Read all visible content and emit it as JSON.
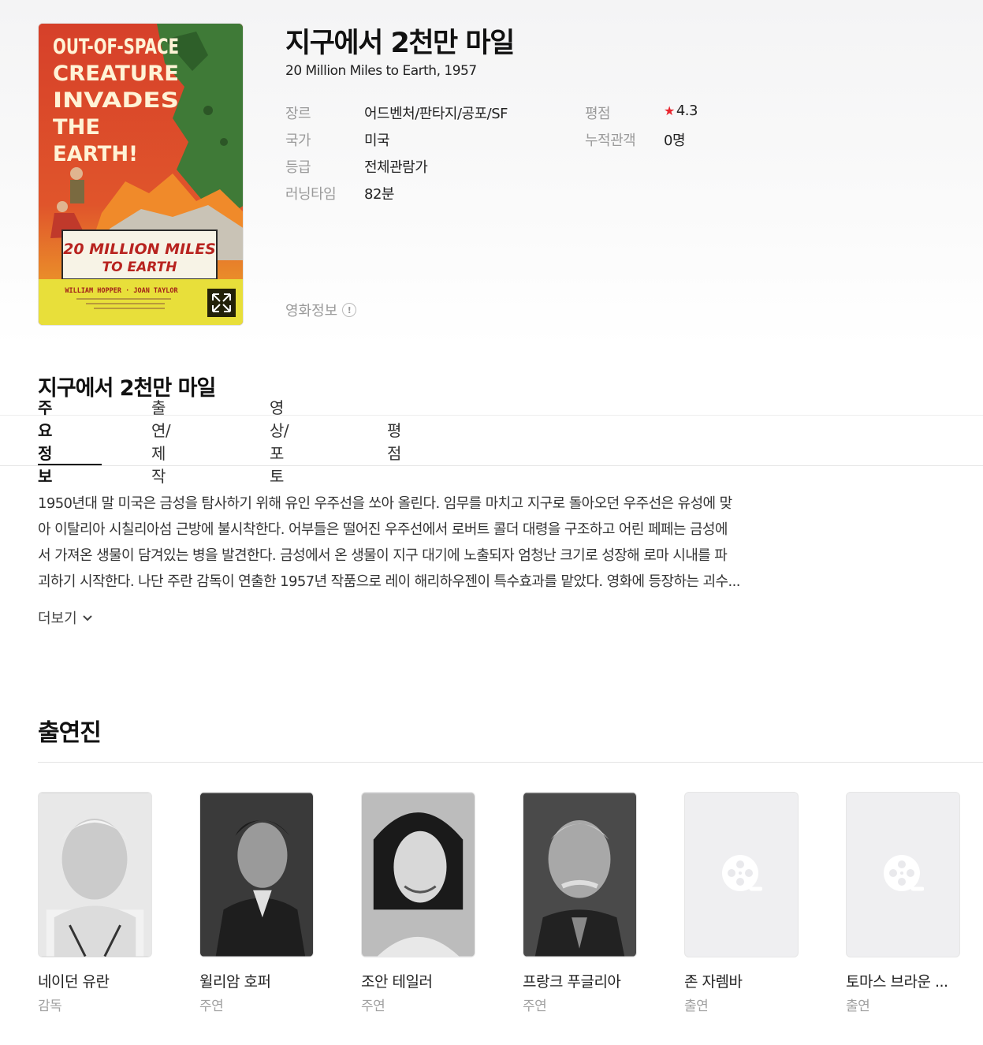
{
  "movie": {
    "title_ko": "지구에서 2천만 마일",
    "title_en_year": "20 Million Miles to Earth, 1957",
    "poster": {
      "headline_lines": [
        "OUT-OF-SPACE",
        "CREATURE",
        "INVADES",
        "THE",
        "EARTH!"
      ],
      "title_line1": "20 MILLION MILES",
      "title_line2": "TO EARTH",
      "starring": "WILLIAM HOPPER · JOAN TAYLOR",
      "expand_icon": "expand-icon"
    },
    "info": [
      {
        "label": "장르",
        "value": "어드벤처/판타지/공포/SF"
      },
      {
        "label": "국가",
        "value": "미국"
      },
      {
        "label": "등급",
        "value": "전체관람가"
      },
      {
        "label": "러닝타임",
        "value": "82분"
      }
    ],
    "info_right": [
      {
        "label": "평점",
        "value": "4.3"
      },
      {
        "label": "누적관객",
        "value": "0명"
      }
    ],
    "rating_star": "★",
    "movie_info_link": "영화정보",
    "movie_info_icon": "!"
  },
  "section_title": "지구에서 2천만 마일",
  "tabs": [
    {
      "label": "주요정보"
    },
    {
      "label": "출연/제작"
    },
    {
      "label": "영상/포토"
    },
    {
      "label": "평점"
    }
  ],
  "synopsis_lines": [
    "1950년대 말 미국은 금성을 탐사하기 위해 유인 우주선을 쏘아 올린다. 임무를 마치고 지구로 돌아오던 우주선은 유성에 맞",
    "아 이탈리아 시칠리아섬 근방에 불시착한다. 어부들은 떨어진 우주선에서 로버트 콜더 대령을 구조하고 어린 페페는 금성에",
    "서 가져온 생물이 담겨있는 병을 발견한다. 금성에서 온 생물이 지구 대기에 노출되자 엄청난 크기로 성장해 로마 시내를 파",
    "괴하기 시작한다. 나단 주란 감독이 연출한 1957년 작품으로 레이 해리하우젠이 특수효과를 맡았다. 영화에 등장하는 괴수..."
  ],
  "more_label": "더보기",
  "cast_title": "출연진",
  "cast": [
    {
      "name": "네이던 유란",
      "role": "감독"
    },
    {
      "name": "윌리암 호퍼",
      "role": "주연"
    },
    {
      "name": "조안 테일러",
      "role": "주연"
    },
    {
      "name": "프랑크 푸글리아",
      "role": "주연"
    },
    {
      "name": "존 자렘바",
      "role": "출연"
    },
    {
      "name": "토마스 브라운 ...",
      "role": "출연"
    }
  ],
  "colors": {
    "accent_star": "#e8262f",
    "muted": "#9a9a9a"
  }
}
